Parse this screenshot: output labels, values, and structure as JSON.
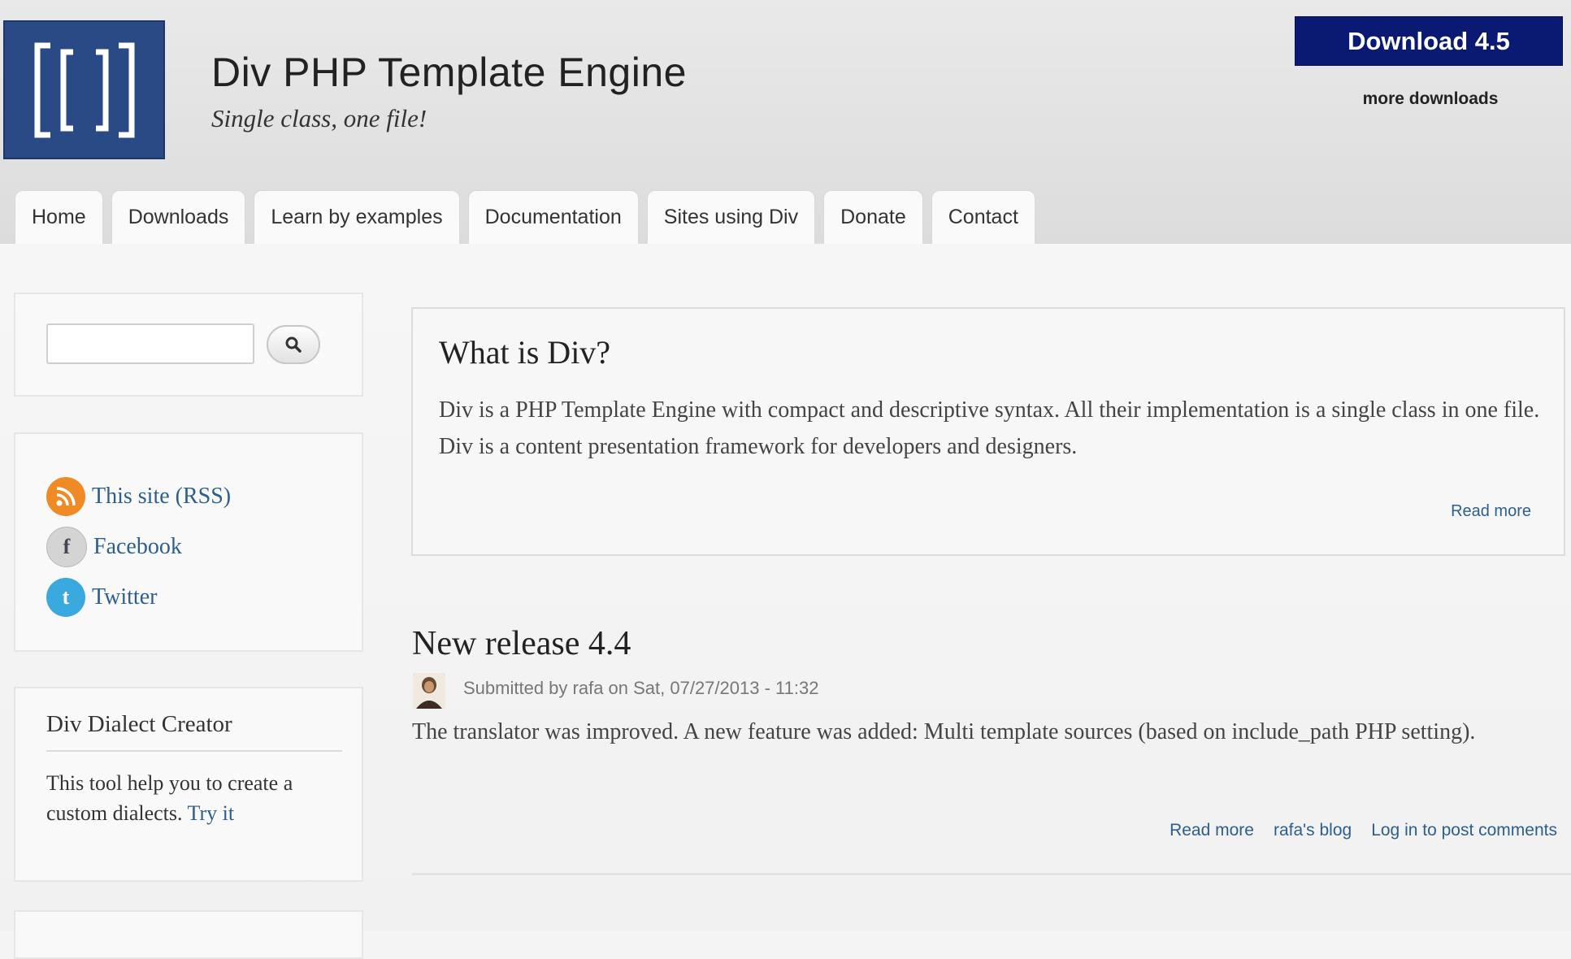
{
  "header": {
    "site_title": "Div PHP Template Engine",
    "slogan": "Single class, one file!",
    "download_label": "Download 4.5",
    "more_downloads": "more downloads"
  },
  "tabs": [
    "Home",
    "Downloads",
    "Learn by examples",
    "Documentation",
    "Sites using Div",
    "Donate",
    "Contact"
  ],
  "sidebar": {
    "search": {
      "placeholder": "",
      "button_icon": "search-icon"
    },
    "links": [
      {
        "label": "This site (RSS)",
        "icon": "rss-icon",
        "color": "#f08a24"
      },
      {
        "label": "Facebook",
        "icon": "facebook-icon",
        "color": "#c9c9c9"
      },
      {
        "label": "Twitter",
        "icon": "twitter-icon",
        "color": "#3aa9dd"
      }
    ],
    "dialect": {
      "title": "Div Dialect Creator",
      "text": "This tool help you to create a custom dialects.",
      "link": "Try it"
    }
  },
  "intro": {
    "title": "What is Div?",
    "text": "Div is a PHP Template Engine with compact and descriptive syntax. All their implementation is a single class in one file. Div is a content presentation framework for developers and designers.",
    "read_more": "Read more"
  },
  "node": {
    "title": "New release 4.4",
    "submitted": "Submitted by rafa on Sat, 07/27/2013 - 11:32",
    "body": "The translator was improved. A new feature was added: Multi template sources (based on include_path PHP setting).",
    "links": [
      "Read more",
      "rafa's blog",
      "Log in to post comments"
    ]
  },
  "colors": {
    "logo_bg": "#2a4a86",
    "download_bg": "#0a1a73",
    "link": "#2c5f8e"
  }
}
